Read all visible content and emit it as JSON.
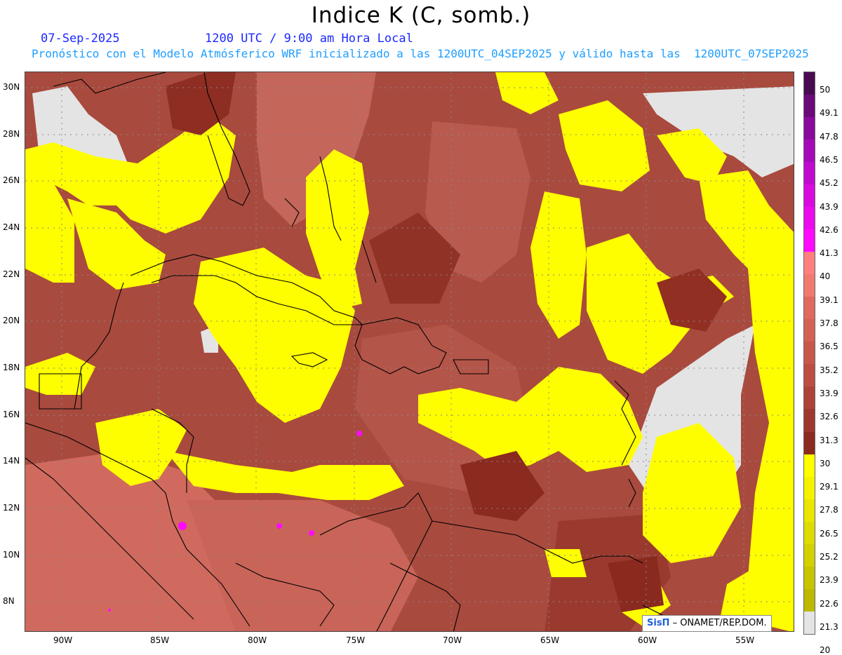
{
  "header": {
    "title": "Indice K (C, somb.)",
    "date": "07-Sep-2025",
    "time": "1200 UTC / 9:00 am Hora Local",
    "subtitle": "Pronóstico con el Modelo Atmósferico WRF inicializado a las 1200UTC_04SEP2025 y válido hasta las  1200UTC_07SEP2025"
  },
  "axes": {
    "lat_labels": [
      "30N",
      "28N",
      "26N",
      "24N",
      "22N",
      "20N",
      "18N",
      "16N",
      "14N",
      "12N",
      "10N",
      "8N"
    ],
    "lon_labels": [
      "90W",
      "85W",
      "80W",
      "75W",
      "70W",
      "65W",
      "60W",
      "55W"
    ]
  },
  "colorbar": {
    "labels": [
      "50",
      "49.1",
      "47.8",
      "46.5",
      "45.2",
      "43.9",
      "42.6",
      "41.3",
      "40",
      "39.1",
      "37.8",
      "36.5",
      "35.2",
      "33.9",
      "32.6",
      "31.3",
      "30",
      "29.1",
      "27.8",
      "26.5",
      "25.2",
      "23.9",
      "22.6",
      "21.3",
      "20"
    ],
    "colors": [
      "#4a0a52",
      "#6a0a78",
      "#8a0a9e",
      "#a50ab8",
      "#c10acf",
      "#d90ae0",
      "#ec0aee",
      "#ff0aff",
      "#ff7f7f",
      "#f07a6e",
      "#e06a5d",
      "#d46154",
      "#c8574b",
      "#bb4d42",
      "#ad4338",
      "#9e382d",
      "#8c2c20",
      "#fefe00",
      "#f5f200",
      "#eae600",
      "#dedb00",
      "#d3d000",
      "#c8c400",
      "#bdb900",
      "#e4e4e4"
    ]
  },
  "credit": {
    "logo": "SisΠ",
    "text": " – ONAMET/REP.DOM."
  },
  "colors": {
    "date_text": "#1c28ff",
    "subtitle_text": "#1e9eff",
    "low_index": "#fefe00",
    "no_data": "#e4e4e4",
    "high_index": "#a94a3e"
  }
}
